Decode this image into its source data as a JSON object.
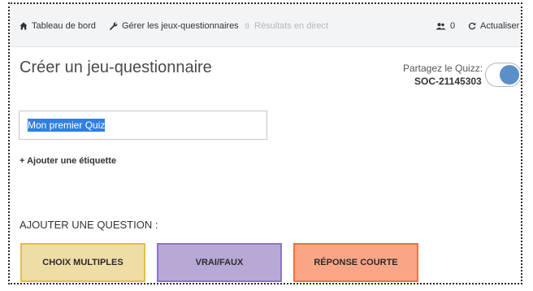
{
  "nav": {
    "dashboard": "Tableau de bord",
    "manage": "Gérer les jeux-questionnaires",
    "live_results": "Résultats en direct",
    "user_count": "0",
    "refresh": "Actualiser"
  },
  "main": {
    "title": "Créer un jeu-questionnaire",
    "share_label": "Partagez le Quizz:",
    "share_code": "SOC-21145303",
    "share_toggle_on": true,
    "quiz_name_value": "Mon premier Quiz",
    "add_tag": "+ Ajouter une étiquette",
    "add_question_label": "AJOUTER UNE QUESTION :",
    "question_types": {
      "multiple_choice": "CHOIX MULTIPLES",
      "true_false": "VRAI/FAUX",
      "short_answer": "RÉPONSE COURTE"
    }
  },
  "colors": {
    "mc_fill": "#efdda6",
    "tf_fill": "#b8a8d6",
    "sa_fill": "#f9a586",
    "toggle_on": "#5b8fc9",
    "selection": "#2f80e3"
  },
  "icons": {
    "dashboard": "home-icon",
    "manage": "wrench-icon",
    "live_results": "signal-icon",
    "users": "users-icon",
    "refresh": "refresh-icon"
  }
}
